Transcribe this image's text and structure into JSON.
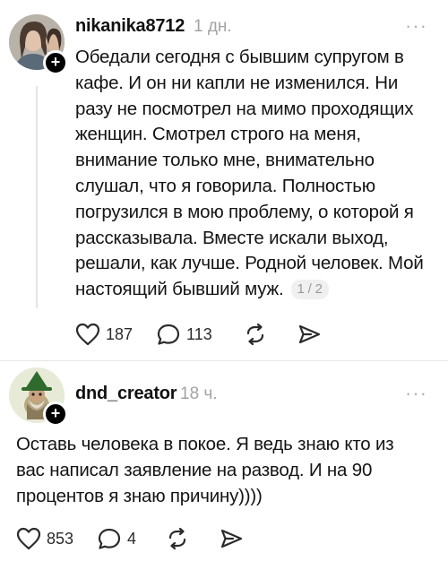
{
  "posts": [
    {
      "username": "nikanika8712",
      "time": "1 дн.",
      "more": "···",
      "text": "Обедали сегодня с бывшим супругом в кафе. И он ни капли не изменился. Ни разу не посмотрел на мимо проходящих женщин. Смотрел строго на меня, внимание только мне, внимательно слушал, что я говорила. Полностью погрузился в мою проблему, о которой я рассказывала. Вместе искали выход, решали, как лучше. Родной человек. Мой настоящий бывший муж.",
      "pager": "1 / 2",
      "likes": "187",
      "replies": "113"
    },
    {
      "username": "dnd_creator",
      "time": "18 ч.",
      "more": "···",
      "text": "Оставь человека в покое. Я ведь знаю кто из вас написал заявление на развод. И на 90 процентов я знаю причину))))",
      "likes": "853",
      "replies": "4"
    }
  ],
  "colors": {
    "text": "#141414",
    "muted": "#a3a3a3",
    "badge": "#000000",
    "line": "#e5e5e5"
  },
  "icons": [
    "heart-icon",
    "comment-icon",
    "repost-icon",
    "share-icon",
    "plus-icon",
    "more-icon"
  ]
}
